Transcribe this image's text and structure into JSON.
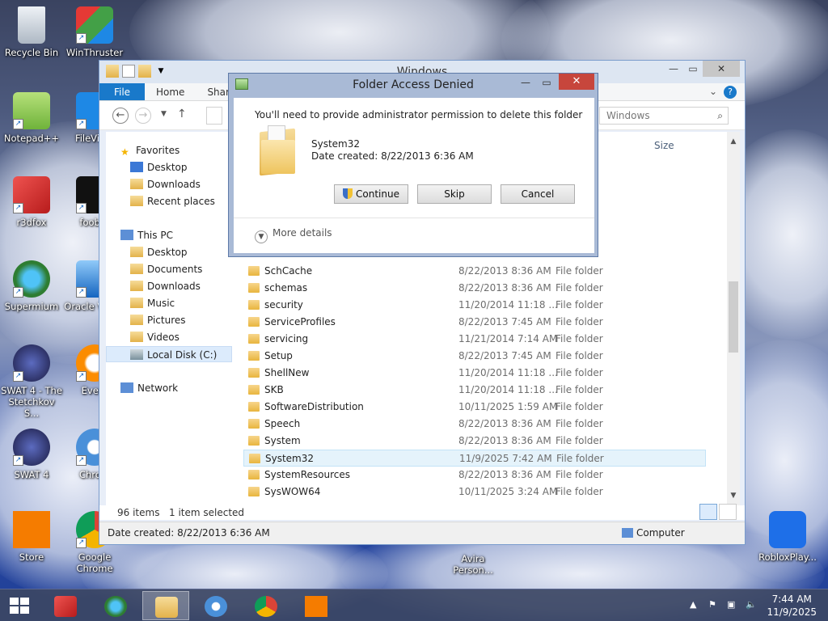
{
  "desktop": {
    "icons": [
      {
        "label": "Recycle Bin"
      },
      {
        "label": "WinThruster"
      },
      {
        "label": "Notepad++"
      },
      {
        "label": "FileVie..."
      },
      {
        "label": "r3dfox"
      },
      {
        "label": "foobar"
      },
      {
        "label": "Supermium"
      },
      {
        "label": "Oracle Virtua"
      },
      {
        "label": "SWAT 4 - The Stetchkov S..."
      },
      {
        "label": "Every"
      },
      {
        "label": "SWAT 4"
      },
      {
        "label": "Chrom"
      },
      {
        "label": "Store"
      },
      {
        "label": "Google Chrome"
      },
      {
        "label": "Avira Person..."
      },
      {
        "label": "RobloxPlay..."
      }
    ]
  },
  "explorer": {
    "title": "Windows",
    "tabs": {
      "file": "File",
      "home": "Home",
      "share": "Shar"
    },
    "search_placeholder": "Windows",
    "column_size": "Size",
    "nav": {
      "favorites": "Favorites",
      "desktop": "Desktop",
      "downloads": "Downloads",
      "recent": "Recent places",
      "thispc": "This PC",
      "pc_desktop": "Desktop",
      "documents": "Documents",
      "pc_downloads": "Downloads",
      "music": "Music",
      "pictures": "Pictures",
      "videos": "Videos",
      "localdisk": "Local Disk (C:)",
      "network": "Network"
    },
    "rows": [
      {
        "name": "SchCache",
        "date": "8/22/2013 8:36 AM",
        "type": "File folder"
      },
      {
        "name": "schemas",
        "date": "8/22/2013 8:36 AM",
        "type": "File folder"
      },
      {
        "name": "security",
        "date": "11/20/2014 11:18 ...",
        "type": "File folder"
      },
      {
        "name": "ServiceProfiles",
        "date": "8/22/2013 7:45 AM",
        "type": "File folder"
      },
      {
        "name": "servicing",
        "date": "11/21/2014 7:14 AM",
        "type": "File folder"
      },
      {
        "name": "Setup",
        "date": "8/22/2013 7:45 AM",
        "type": "File folder"
      },
      {
        "name": "ShellNew",
        "date": "11/20/2014 11:18 ...",
        "type": "File folder"
      },
      {
        "name": "SKB",
        "date": "11/20/2014 11:18 ...",
        "type": "File folder"
      },
      {
        "name": "SoftwareDistribution",
        "date": "10/11/2025 1:59 AM",
        "type": "File folder"
      },
      {
        "name": "Speech",
        "date": "8/22/2013 8:36 AM",
        "type": "File folder"
      },
      {
        "name": "System",
        "date": "8/22/2013 8:36 AM",
        "type": "File folder"
      },
      {
        "name": "System32",
        "date": "11/9/2025 7:42 AM",
        "type": "File folder"
      },
      {
        "name": "SystemResources",
        "date": "8/22/2013 8:36 AM",
        "type": "File folder"
      },
      {
        "name": "SysWOW64",
        "date": "10/11/2025 3:24 AM",
        "type": "File folder"
      }
    ],
    "status": {
      "count": "96 items",
      "selected": "1 item selected"
    },
    "details": {
      "date_created": "Date created: 8/22/2013 6:36 AM",
      "location": "Computer"
    }
  },
  "dialog": {
    "title": "Folder Access Denied",
    "message": "You'll need to provide administrator permission to delete this folder",
    "folder_name": "System32",
    "folder_date": "Date created: 8/22/2013 6:36 AM",
    "continue": "Continue",
    "skip": "Skip",
    "cancel": "Cancel",
    "more": "More details"
  },
  "taskbar": {
    "time": "7:44 AM",
    "date": "11/9/2025"
  }
}
